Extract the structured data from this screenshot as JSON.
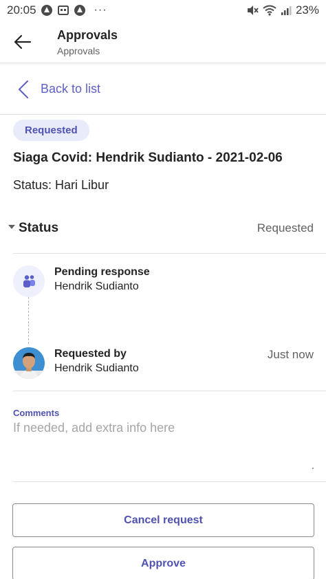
{
  "status_bar": {
    "time": "20:05",
    "battery": "23%",
    "more": "···"
  },
  "header": {
    "title": "Approvals",
    "subtitle": "Approvals"
  },
  "nav": {
    "back_to_list": "Back to list"
  },
  "request": {
    "badge": "Requested",
    "title": "Siaga Covid: Hendrik Sudianto - 2021-02-06",
    "status_line": "Status: Hari Libur"
  },
  "status_section": {
    "label": "Status",
    "value": "Requested",
    "timeline": [
      {
        "title": "Pending response",
        "name": "Hendrik Sudianto",
        "time": "",
        "icon": "teams-icon"
      },
      {
        "title": "Requested by",
        "name": "Hendrik Sudianto",
        "time": "Just now",
        "icon": "avatar"
      }
    ]
  },
  "comments": {
    "label": "Comments",
    "placeholder": "If needed, add extra info here",
    "value": ""
  },
  "buttons": {
    "cancel": "Cancel request",
    "approve": "Approve"
  },
  "colors": {
    "accent": "#4f52b2",
    "accent_light": "#5b5fc7",
    "badge_bg": "#e8ebfa",
    "text": "#242424",
    "secondary_text": "#616161"
  }
}
